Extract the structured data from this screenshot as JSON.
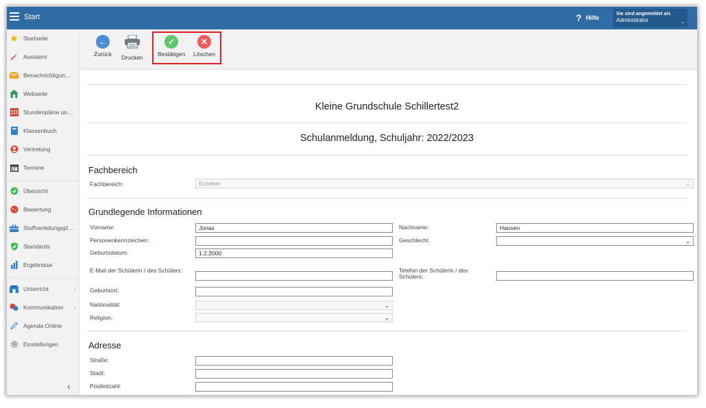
{
  "topbar": {
    "title": "Start",
    "help_icon": "?",
    "help_label": "Hilfe",
    "user_line1": "Sie sind angemeldet als",
    "user_line2": "Administrator",
    "caret": "⌄"
  },
  "sidebar": {
    "items": [
      {
        "label": "Startseite",
        "icon": "star-icon"
      },
      {
        "label": "Assistent",
        "icon": "magic-wand-icon"
      },
      {
        "label": "Benachrichtigungen",
        "icon": "envelope-icon"
      },
      {
        "label": "Webseite",
        "icon": "house-icon"
      },
      {
        "label": "Stundenpläne und Kalender",
        "icon": "calendar-grid-icon"
      },
      {
        "label": "Klassenbuch",
        "icon": "book-icon"
      },
      {
        "label": "Vertretung",
        "icon": "person-icon"
      },
      {
        "label": "Termine",
        "icon": "calendar-icon"
      },
      {
        "label": "Übersicht",
        "icon": "check-circle-icon"
      },
      {
        "label": "Bewertung",
        "icon": "rating-icon"
      },
      {
        "label": "Stoffverteilungsplan",
        "icon": "briefcase-icon"
      },
      {
        "label": "Standards",
        "icon": "shield-check-icon"
      },
      {
        "label": "Ergebnisse",
        "icon": "bar-chart-icon"
      },
      {
        "label": "Unterricht",
        "icon": "classroom-icon",
        "chevron": "›"
      },
      {
        "label": "Kommunikation",
        "icon": "chat-icon",
        "chevron": "›"
      },
      {
        "label": "Agenda Online",
        "icon": "pen-icon"
      },
      {
        "label": "Einstellungen",
        "icon": "gear-icon"
      }
    ],
    "collapse": "‹"
  },
  "toolbar": {
    "back_label": "Zurück",
    "print_label": "Drucken",
    "confirm_label": "Bestätigen",
    "delete_label": "Löschen",
    "back_glyph": "←",
    "confirm_glyph": "✓",
    "delete_glyph": "✕"
  },
  "form": {
    "school_name": "Kleine Grundschule Schillertest2",
    "form_title": "Schulanmeldung, Schuljahr: 2022/2023",
    "sections": {
      "fachbereich": "Fachbereich",
      "grundlegende": "Grundlegende Informationen",
      "adresse": "Adresse"
    },
    "fields": {
      "fachbereich_label": "Fachbereich:",
      "fachbereich_value": "Erzieher",
      "vorname_label": "Vorname:",
      "vorname_value": "Jonas",
      "nachname_label": "Nachname:",
      "nachname_value": "Hansen",
      "pkz_label": "Personenkennzeichen:",
      "pkz_value": "",
      "geschlecht_label": "Geschlecht:",
      "geschlecht_value": "",
      "geburtsdatum_label": "Geburtsdatum:",
      "geburtsdatum_value": "1.2.2000",
      "email_label": "E-Mail der Schülerin / des Schülers:",
      "email_value": "",
      "telefon_label": "Telefon der Schülerin / des Schülers:",
      "telefon_value": "",
      "geburtsort_label": "Geburtsort:",
      "geburtsort_value": "",
      "nationalitaet_label": "Nationalität:",
      "nationalitaet_value": "",
      "religion_label": "Religion:",
      "religion_value": "",
      "strasse_label": "Straße:",
      "strasse_value": "",
      "stadt_label": "Stadt:",
      "stadt_value": "",
      "plz_label": "Postleitzahl:",
      "plz_value": ""
    },
    "dropdown_arrow": "⌄"
  },
  "colors": {
    "topbar": "#2f6ca6",
    "back": "#4a8fd6",
    "confirm": "#5cc86b",
    "delete": "#ef5a5a",
    "highlight": "#e41c24"
  }
}
